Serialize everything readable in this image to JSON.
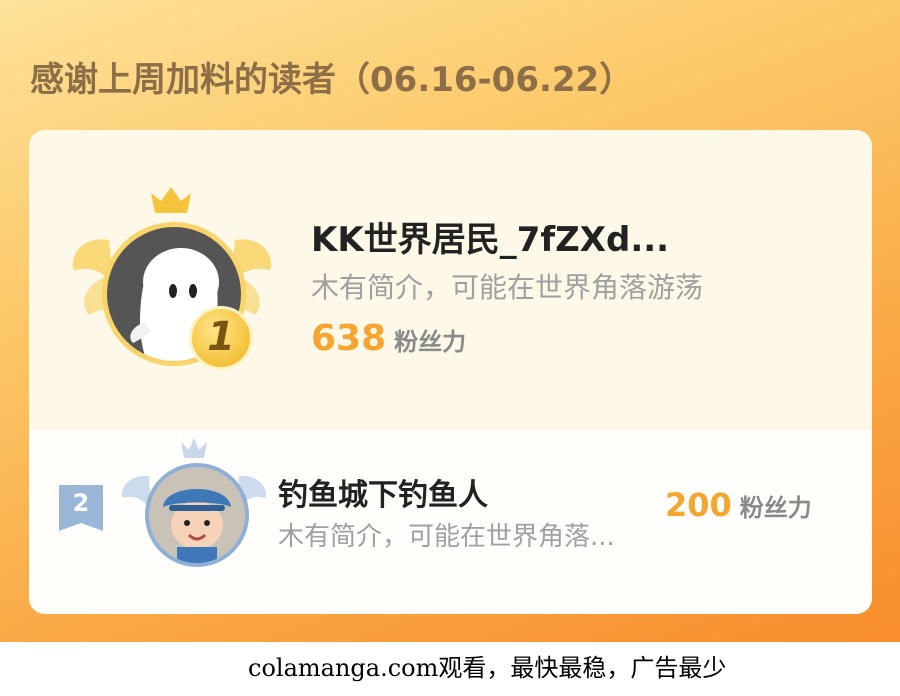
{
  "board": {
    "title": "感谢上周加料的读者（06.16-06.22）",
    "accent_color": "#f5a530",
    "background_colors": [
      "#fde29a",
      "#f88d2c"
    ]
  },
  "readers": [
    {
      "rank": "1",
      "name": "KK世界居民_7fZXd...",
      "bio": "木有简介，可能在世界角落游荡",
      "fans_count": "638",
      "fans_unit": "粉丝力",
      "avatar_icon": "ghost-avatar-icon",
      "badge_icon": "gold-medal-icon"
    },
    {
      "rank": "2",
      "name": "钓鱼城下钓鱼人",
      "bio": "木有简介，可能在世界角落...",
      "fans_count": "200",
      "fans_unit": "粉丝力",
      "avatar_icon": "baby-photo-avatar",
      "badge_icon": "silver-rank-badge-icon"
    }
  ],
  "watermark": "colamanga.com观看，最快最稳，广告最少"
}
